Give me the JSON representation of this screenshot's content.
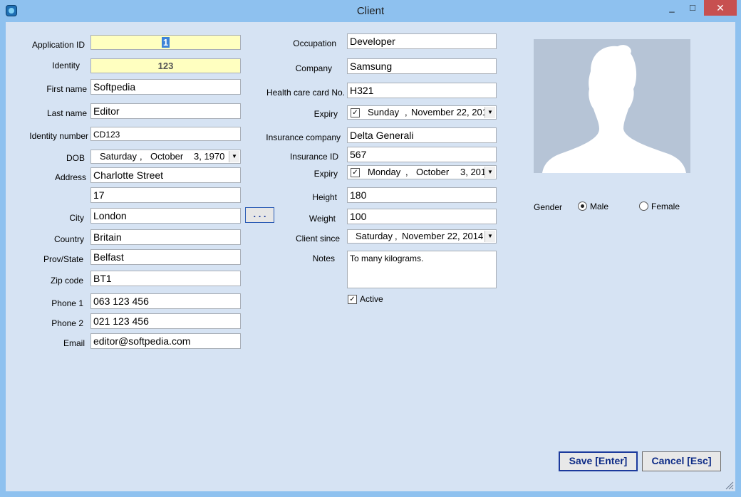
{
  "window": {
    "title": "Client",
    "min_glyph": "_",
    "max_glyph": "□",
    "close_glyph": "✕"
  },
  "labels": {
    "application_id": "Application ID",
    "identity": "Identity",
    "first_name": "First name",
    "last_name": "Last name",
    "identity_number": "Identity number",
    "dob": "DOB",
    "address": "Address",
    "city": "City",
    "country": "Country",
    "prov_state": "Prov/State",
    "zip_code": "Zip code",
    "phone1": "Phone 1",
    "phone2": "Phone 2",
    "email": "Email",
    "occupation": "Occupation",
    "company": "Company",
    "health_card": "Health care card No.",
    "expiry1": "Expiry",
    "insurance_company": "Insurance company",
    "insurance_id": "Insurance ID",
    "expiry2": "Expiry",
    "height": "Height",
    "weight": "Weight",
    "client_since": "Client since",
    "notes": "Notes",
    "active": "Active",
    "gender": "Gender",
    "male": "Male",
    "female": "Female"
  },
  "values": {
    "application_id": "1",
    "identity": "123",
    "first_name": "Softpedia",
    "last_name": "Editor",
    "identity_number": "CD123",
    "dob_day": "Saturday",
    "dob_month": "October",
    "dob_date": "3, 1970",
    "address1": "Charlotte Street",
    "address2": "17",
    "city": "London",
    "city_button": ". . .",
    "country": "Britain",
    "prov_state": "Belfast",
    "zip_code": "BT1",
    "phone1": "063 123 456",
    "phone2": "021 123 456",
    "email": "editor@softpedia.com",
    "occupation": "Developer",
    "company": "Samsung",
    "health_card": "H321",
    "expiry1_day": "Sunday",
    "expiry1_date": "November 22, 201",
    "insurance_company": "Delta Generali",
    "insurance_id": "567",
    "expiry2_day": "Monday",
    "expiry2_month": "October",
    "expiry2_date": "3, 201",
    "height": "180",
    "weight": "100",
    "client_since_day": "Saturday",
    "client_since_date": "November 22, 2014",
    "notes": "To many kilograms.",
    "active": true,
    "gender": "Male"
  },
  "buttons": {
    "save": "Save [Enter]",
    "cancel": "Cancel [Esc]"
  },
  "colors": {
    "titlebar": "#8ec1ef",
    "client_bg": "#d6e3f3",
    "yellow_field": "#ffffc0",
    "close": "#c75050",
    "button_text": "#0c2a86"
  },
  "icons": {
    "app": "app-icon",
    "dropdown": "chevron-down-icon",
    "photo": "person-silhouette-icon"
  }
}
